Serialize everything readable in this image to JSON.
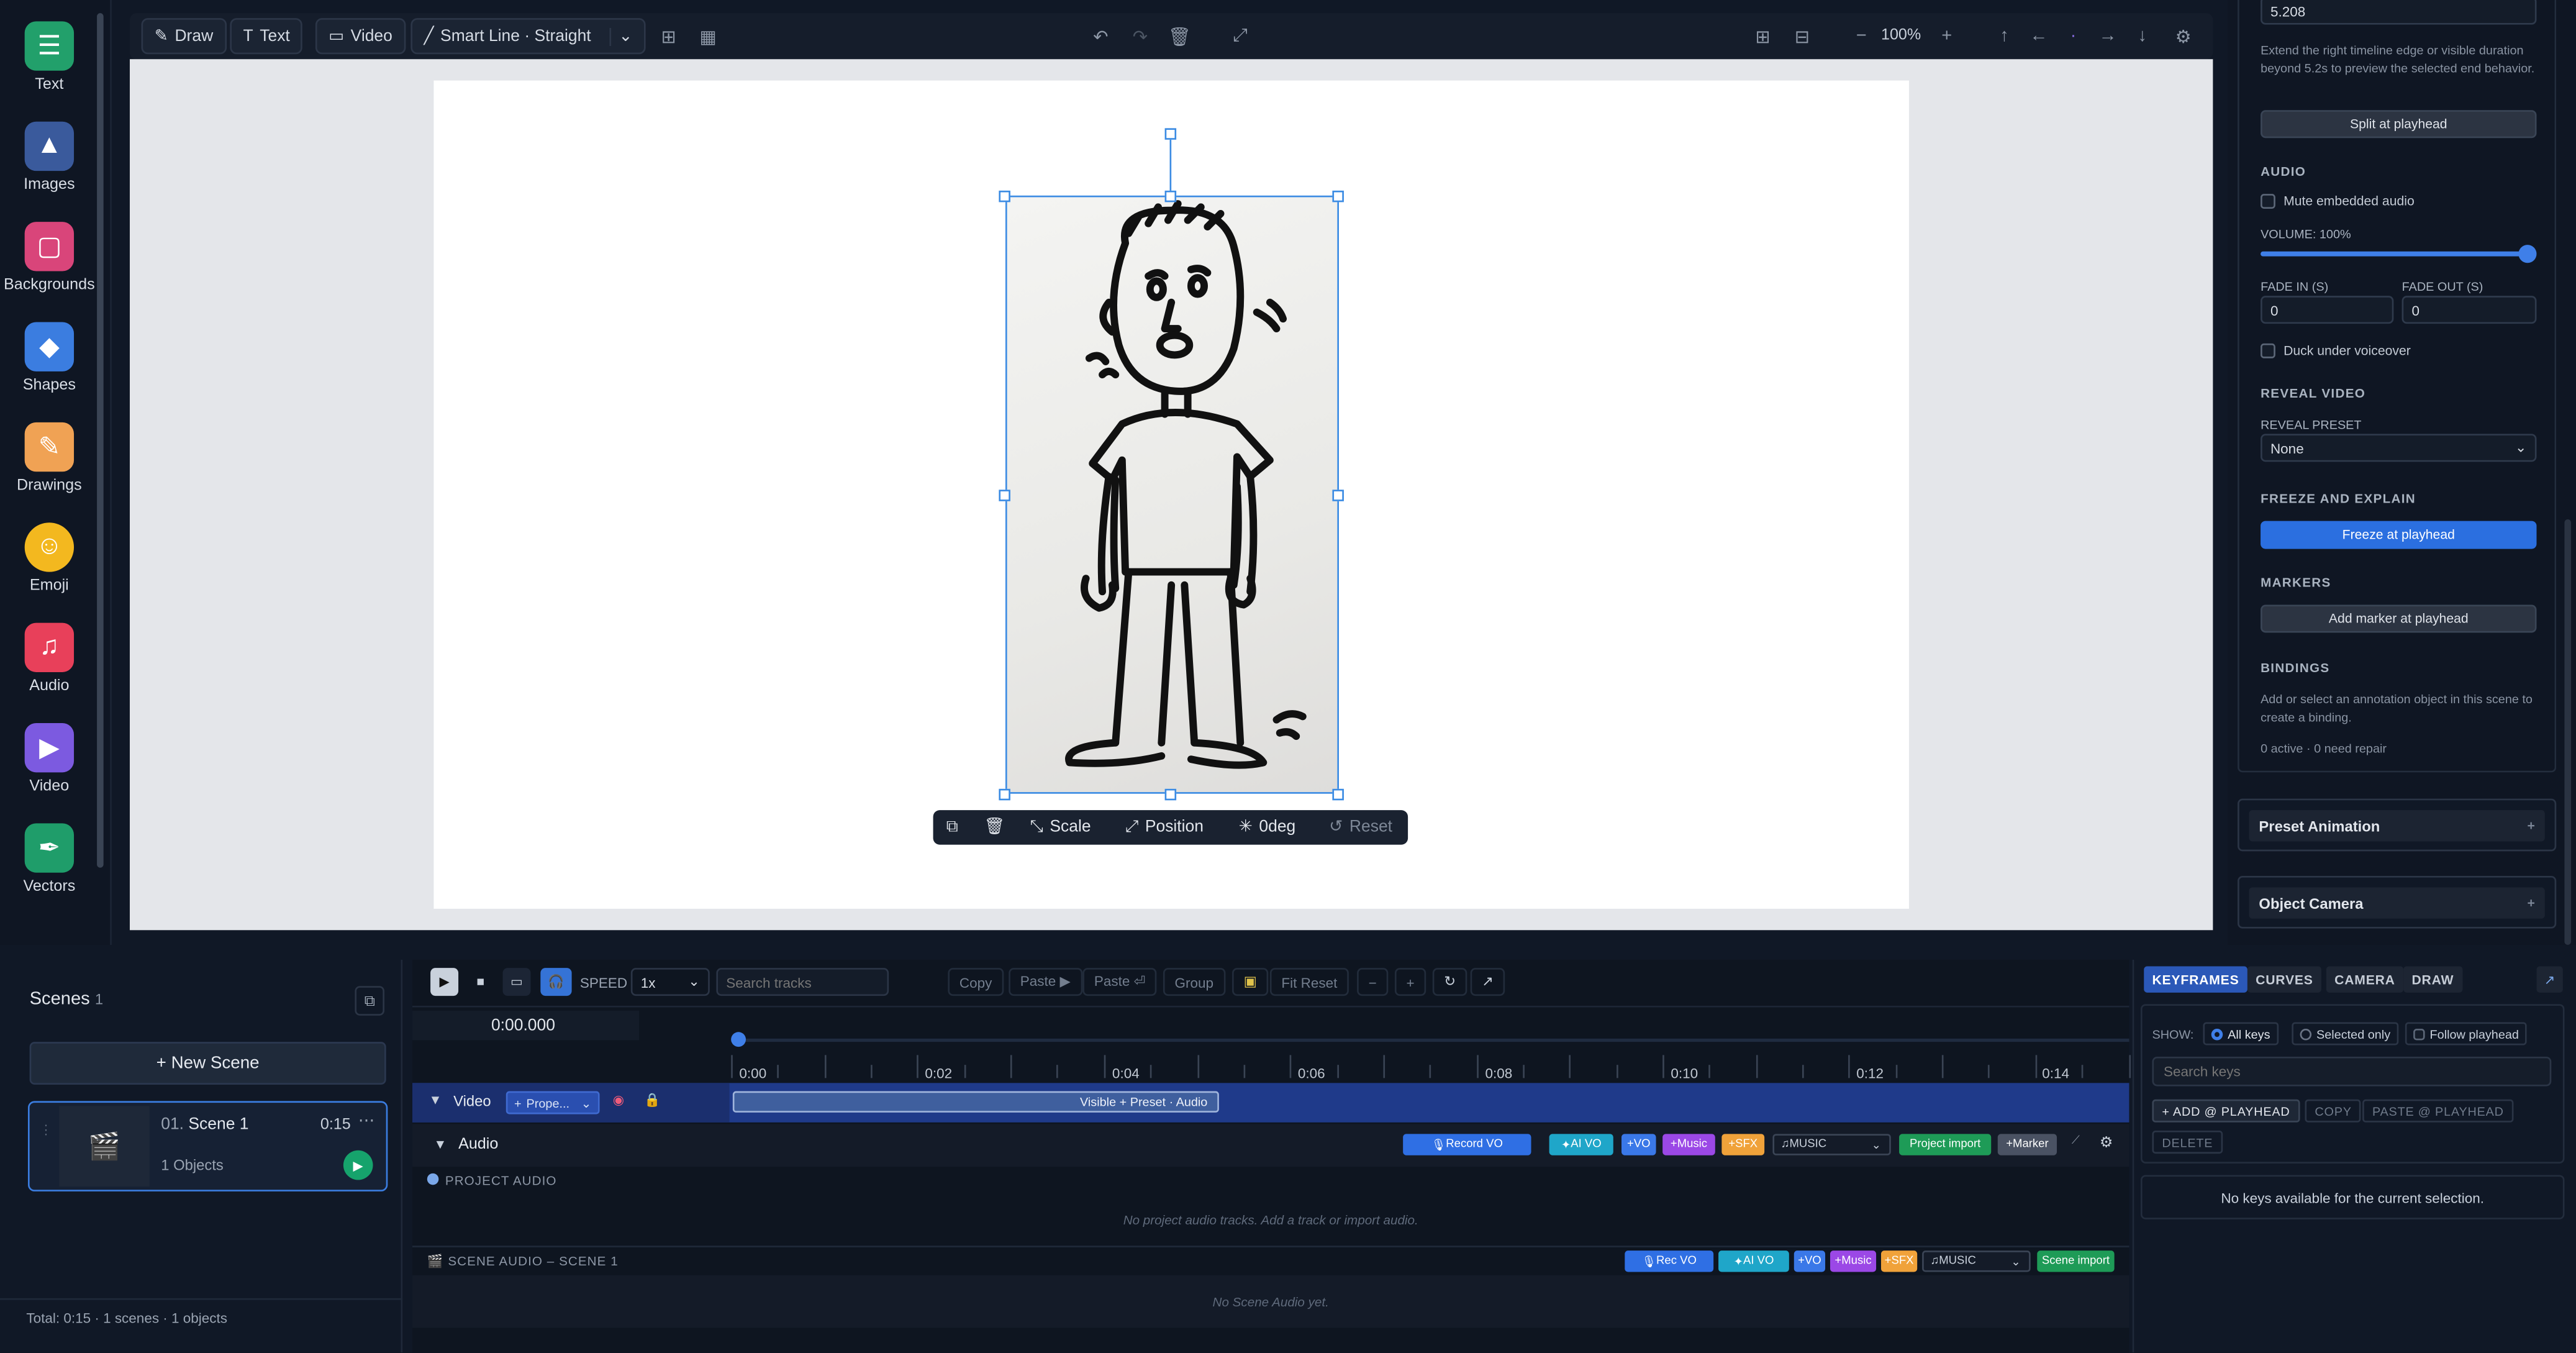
{
  "sidebar": {
    "items": [
      {
        "label": "Text",
        "icon": "text-icon",
        "color": "#22a06b"
      },
      {
        "label": "Images",
        "icon": "image-icon",
        "color": "#3a5a9c"
      },
      {
        "label": "Backgrounds",
        "icon": "background-icon",
        "color": "#d9457a"
      },
      {
        "label": "Shapes",
        "icon": "shapes-icon",
        "color": "#3b7de0"
      },
      {
        "label": "Drawings",
        "icon": "palette-icon",
        "color": "#f0a254"
      },
      {
        "label": "Emoji",
        "icon": "smile-icon",
        "color": "#f3b81f"
      },
      {
        "label": "Audio",
        "icon": "music-icon",
        "color": "#e8405a"
      },
      {
        "label": "Video",
        "icon": "video-icon",
        "color": "#7c5ae0"
      },
      {
        "label": "Vectors",
        "icon": "pen-icon",
        "color": "#1f9d6a"
      }
    ]
  },
  "toolbar": {
    "draw": "Draw",
    "text": "Text",
    "video": "Video",
    "line_mode": "Smart Line · Straight",
    "zoom": "100%"
  },
  "context_menu": {
    "scale": "Scale",
    "position": "Position",
    "rotation": "0deg",
    "reset": "Reset"
  },
  "right_panel": {
    "end_value": "5.208",
    "end_hint": "Extend the right timeline edge or visible duration beyond 5.2s to preview the selected end behavior.",
    "split_button": "Split at playhead",
    "audio_title": "AUDIO",
    "mute_label": "Mute embedded audio",
    "volume_label": "VOLUME: 100%",
    "volume": 1.0,
    "fade_in_label": "FADE IN (S)",
    "fade_out_label": "FADE OUT (S)",
    "fade_in": "0",
    "fade_out": "0",
    "duck_label": "Duck under voiceover",
    "reveal_title": "REVEAL VIDEO",
    "reveal_preset_label": "REVEAL PRESET",
    "reveal_preset": "None",
    "freeze_title": "FREEZE AND EXPLAIN",
    "freeze_button": "Freeze at playhead",
    "markers_title": "MARKERS",
    "marker_button": "Add marker at playhead",
    "bindings_title": "BINDINGS",
    "bindings_hint": "Add or select an annotation object in this scene to create a binding.",
    "bindings_status": "0 active · 0 need repair",
    "preset_animation": "Preset Animation",
    "object_camera": "Object Camera"
  },
  "scenes": {
    "title": "Scenes",
    "count": "1",
    "new_scene": "+ New Scene",
    "list": [
      {
        "index": "01.",
        "name": "Scene 1",
        "duration": "0:15",
        "objects": "1 Objects"
      }
    ],
    "total": "Total: 0:15 · 1 scenes · 1 objects"
  },
  "timeline": {
    "speed_label": "SPEED",
    "speed": "1x",
    "search_placeholder": "Search tracks",
    "copy": "Copy",
    "paste": "Paste ▶",
    "paste_alt": "Paste ⏎",
    "group": "Group",
    "fit_reset": "Fit Reset",
    "timecode": "0:00.000",
    "ticks": [
      "0:00",
      "0:02",
      "0:04",
      "0:06",
      "0:08",
      "0:10",
      "0:12",
      "0:14"
    ],
    "video_track": "Video",
    "video_prop": "Prope...",
    "clip_label": "Visible + Preset · Audio",
    "audio_track": "Audio",
    "audio_chips": {
      "record": "Record VO",
      "ai_vo": "AI VO",
      "vo": "+VO",
      "music": "+Music",
      "sfx": "+SFX",
      "music_select": "MUSIC",
      "import": "Project import",
      "marker": "+Marker"
    },
    "project_audio": "PROJECT AUDIO",
    "project_audio_empty": "No project audio tracks. Add a track or import audio.",
    "scene_audio": "SCENE AUDIO – SCENE 1",
    "scene_chips": {
      "rec": "Rec VO",
      "ai_vo": "AI VO",
      "vo": "+VO",
      "music": "+Music",
      "sfx": "+SFX",
      "music_select": "MUSIC",
      "import": "Scene import"
    },
    "scene_audio_empty": "No Scene Audio yet."
  },
  "keyframes": {
    "tabs": [
      "KEYFRAMES",
      "CURVES",
      "CAMERA",
      "DRAW"
    ],
    "show_label": "SHOW:",
    "all_keys": "All keys",
    "selected_only": "Selected only",
    "follow": "Follow playhead",
    "search_placeholder": "Search keys",
    "add": "+ ADD @ PLAYHEAD",
    "copy": "COPY",
    "paste": "PASTE @ PLAYHEAD",
    "delete": "DELETE",
    "empty": "No keys available for the current selection."
  }
}
